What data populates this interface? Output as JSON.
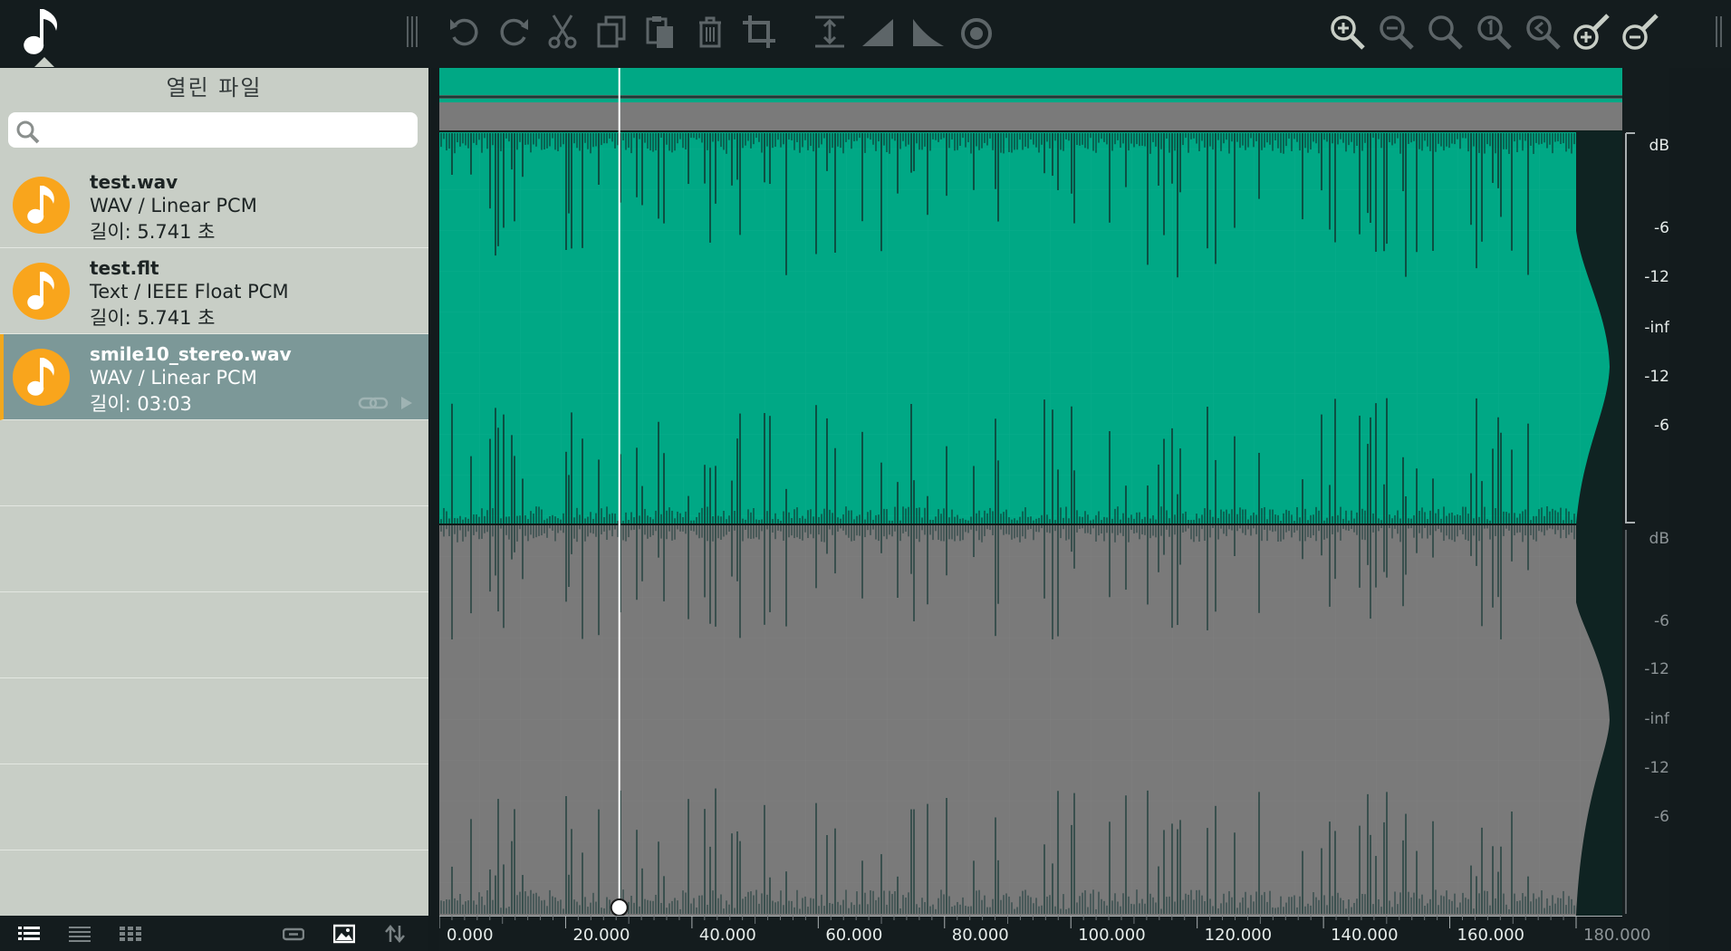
{
  "toolbar": {
    "items": [
      {
        "name": "undo-icon"
      },
      {
        "name": "redo-icon"
      },
      {
        "name": "cut-icon"
      },
      {
        "name": "copy-icon"
      },
      {
        "name": "paste-icon"
      },
      {
        "name": "delete-icon"
      },
      {
        "name": "crop-icon"
      },
      {
        "name": "normalize-icon"
      },
      {
        "name": "fade-in-icon"
      },
      {
        "name": "fade-out-icon"
      },
      {
        "name": "effects-knob-icon"
      },
      {
        "name": "zoom-in-icon"
      },
      {
        "name": "zoom-out-icon"
      },
      {
        "name": "zoom-fit-icon"
      },
      {
        "name": "zoom-one-icon"
      },
      {
        "name": "zoom-back-icon"
      },
      {
        "name": "zoom-in-vertical-icon"
      },
      {
        "name": "zoom-out-vertical-icon"
      }
    ]
  },
  "sidebar": {
    "title": "열린 파일",
    "search": {
      "value": "",
      "placeholder": ""
    },
    "files": [
      {
        "name": "test.wav",
        "format": "WAV / Linear PCM",
        "length": "길이: 5.741 초",
        "selected": false
      },
      {
        "name": "test.flt",
        "format": "Text / IEEE Float PCM",
        "length": "길이: 5.741 초",
        "selected": false
      },
      {
        "name": "smile10_stereo.wav",
        "format": "WAV / Linear PCM",
        "length": "길이: 03:03",
        "selected": true
      }
    ]
  },
  "bottom_bar": {
    "view_modes": [
      "list-detail-icon",
      "list-compact-icon",
      "grid-icon"
    ],
    "actions": [
      "link-icon",
      "image-icon",
      "sort-icon"
    ]
  },
  "waveform": {
    "channel1_color": "#00a885",
    "channel2_color": "#7a7a7a",
    "cursor_time": 28.5,
    "total_length": 180,
    "db_scale_ch1": [
      "dB",
      "-6",
      "-12",
      "-inf",
      "-12",
      "-6"
    ],
    "db_scale_ch2": [
      "dB",
      "-6",
      "-12",
      "-inf",
      "-12",
      "-6"
    ],
    "time_labels": [
      "0.000",
      "20.000",
      "40.000",
      "60.000",
      "80.000",
      "100.000",
      "120.000",
      "140.000",
      "160.000",
      "180.000"
    ]
  }
}
